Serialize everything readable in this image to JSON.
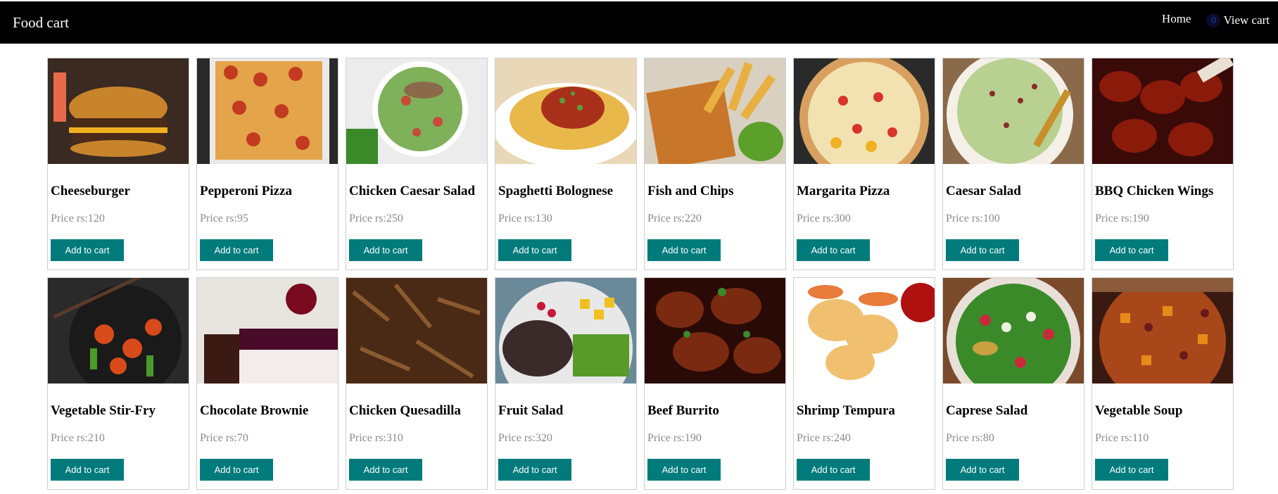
{
  "navbar": {
    "brand": "Food cart",
    "home_label": "Home",
    "cart_count": "0",
    "view_cart_label": "View cart"
  },
  "price_prefix": "Price rs:",
  "add_label": "Add to cart",
  "colors": {
    "navbar_bg": "#000000",
    "button_bg": "#007b7b",
    "price_text": "#8a8a8a"
  },
  "products": [
    {
      "name": "Cheeseburger",
      "price": "120",
      "icon": "cheeseburger-image"
    },
    {
      "name": "Pepperoni Pizza",
      "price": "95",
      "icon": "pepperoni-pizza-image"
    },
    {
      "name": "Chicken Caesar Salad",
      "price": "250",
      "icon": "chicken-caesar-salad-image"
    },
    {
      "name": "Spaghetti Bolognese",
      "price": "130",
      "icon": "spaghetti-image"
    },
    {
      "name": "Fish and Chips",
      "price": "220",
      "icon": "fish-and-chips-image"
    },
    {
      "name": "Margarita Pizza",
      "price": "300",
      "icon": "margarita-pizza-image"
    },
    {
      "name": "Caesar Salad",
      "price": "100",
      "icon": "caesar-salad-image"
    },
    {
      "name": "BBQ Chicken Wings",
      "price": "190",
      "icon": "bbq-wings-image"
    },
    {
      "name": "Vegetable Stir-Fry",
      "price": "210",
      "icon": "stir-fry-image"
    },
    {
      "name": "Chocolate Brownie",
      "price": "70",
      "icon": "brownie-image"
    },
    {
      "name": "Chicken Quesadilla",
      "price": "310",
      "icon": "quesadilla-image"
    },
    {
      "name": "Fruit Salad",
      "price": "320",
      "icon": "fruit-salad-image"
    },
    {
      "name": "Beef Burrito",
      "price": "190",
      "icon": "beef-burrito-image"
    },
    {
      "name": "Shrimp Tempura",
      "price": "240",
      "icon": "shrimp-tempura-image"
    },
    {
      "name": "Caprese Salad",
      "price": "80",
      "icon": "caprese-salad-image"
    },
    {
      "name": "Vegetable Soup",
      "price": "110",
      "icon": "vegetable-soup-image"
    }
  ]
}
